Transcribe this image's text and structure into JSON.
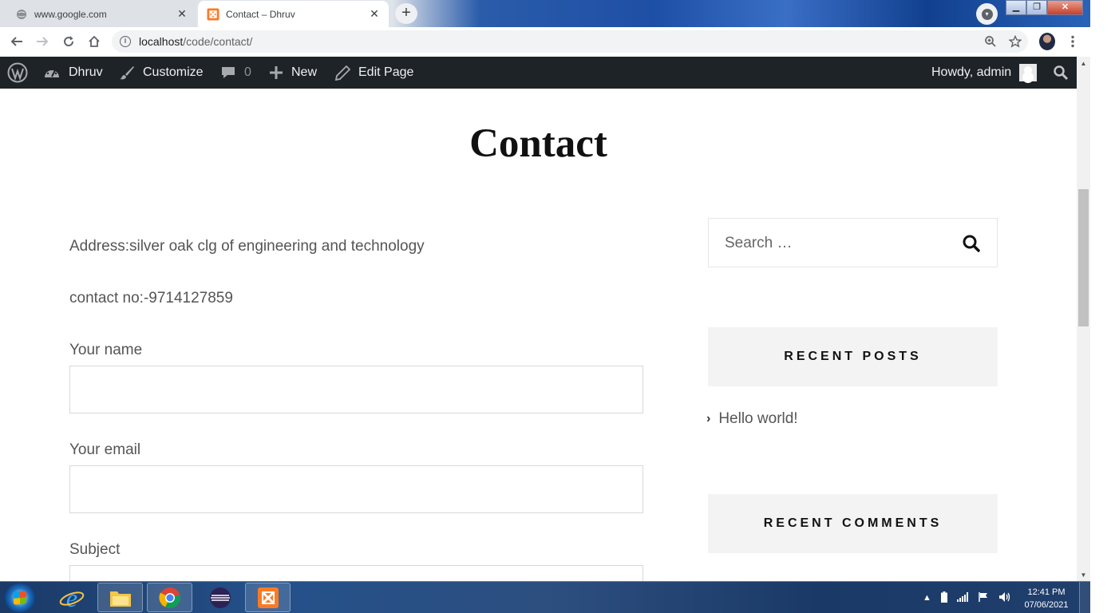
{
  "browser": {
    "tabs": [
      {
        "title": "www.google.com",
        "favicon": "globe-icon",
        "active": false
      },
      {
        "title": "Contact – Dhruv",
        "favicon": "xampp-icon",
        "active": true
      }
    ],
    "url": {
      "host": "localhost",
      "path": "/code/contact/"
    }
  },
  "adminbar": {
    "site_name": "Dhruv",
    "customize": "Customize",
    "comments_count": "0",
    "new": "New",
    "edit_page": "Edit Page",
    "howdy": "Howdy, admin"
  },
  "page": {
    "title": "Contact",
    "address": "Address:silver oak clg of engineering and technology",
    "contact_no": "contact no:-9714127859",
    "form": {
      "name_label": "Your name",
      "email_label": "Your email",
      "subject_label": "Subject"
    }
  },
  "sidebar": {
    "search_placeholder": "Search …",
    "recent_posts_title": "RECENT POSTS",
    "recent_posts": [
      {
        "title": "Hello world!"
      }
    ],
    "recent_comments_title": "RECENT COMMENTS"
  },
  "taskbar": {
    "time": "12:41 PM",
    "date": "07/06/2021",
    "apps": [
      "explorer-icon",
      "internet-explorer-icon",
      "file-explorer-icon",
      "chrome-icon",
      "eclipse-icon",
      "xampp-icon"
    ]
  },
  "colors": {
    "adminbar_bg": "#1d2327",
    "widget_bg": "#f3f3f3",
    "text_body": "#555555",
    "title": "#111111"
  }
}
